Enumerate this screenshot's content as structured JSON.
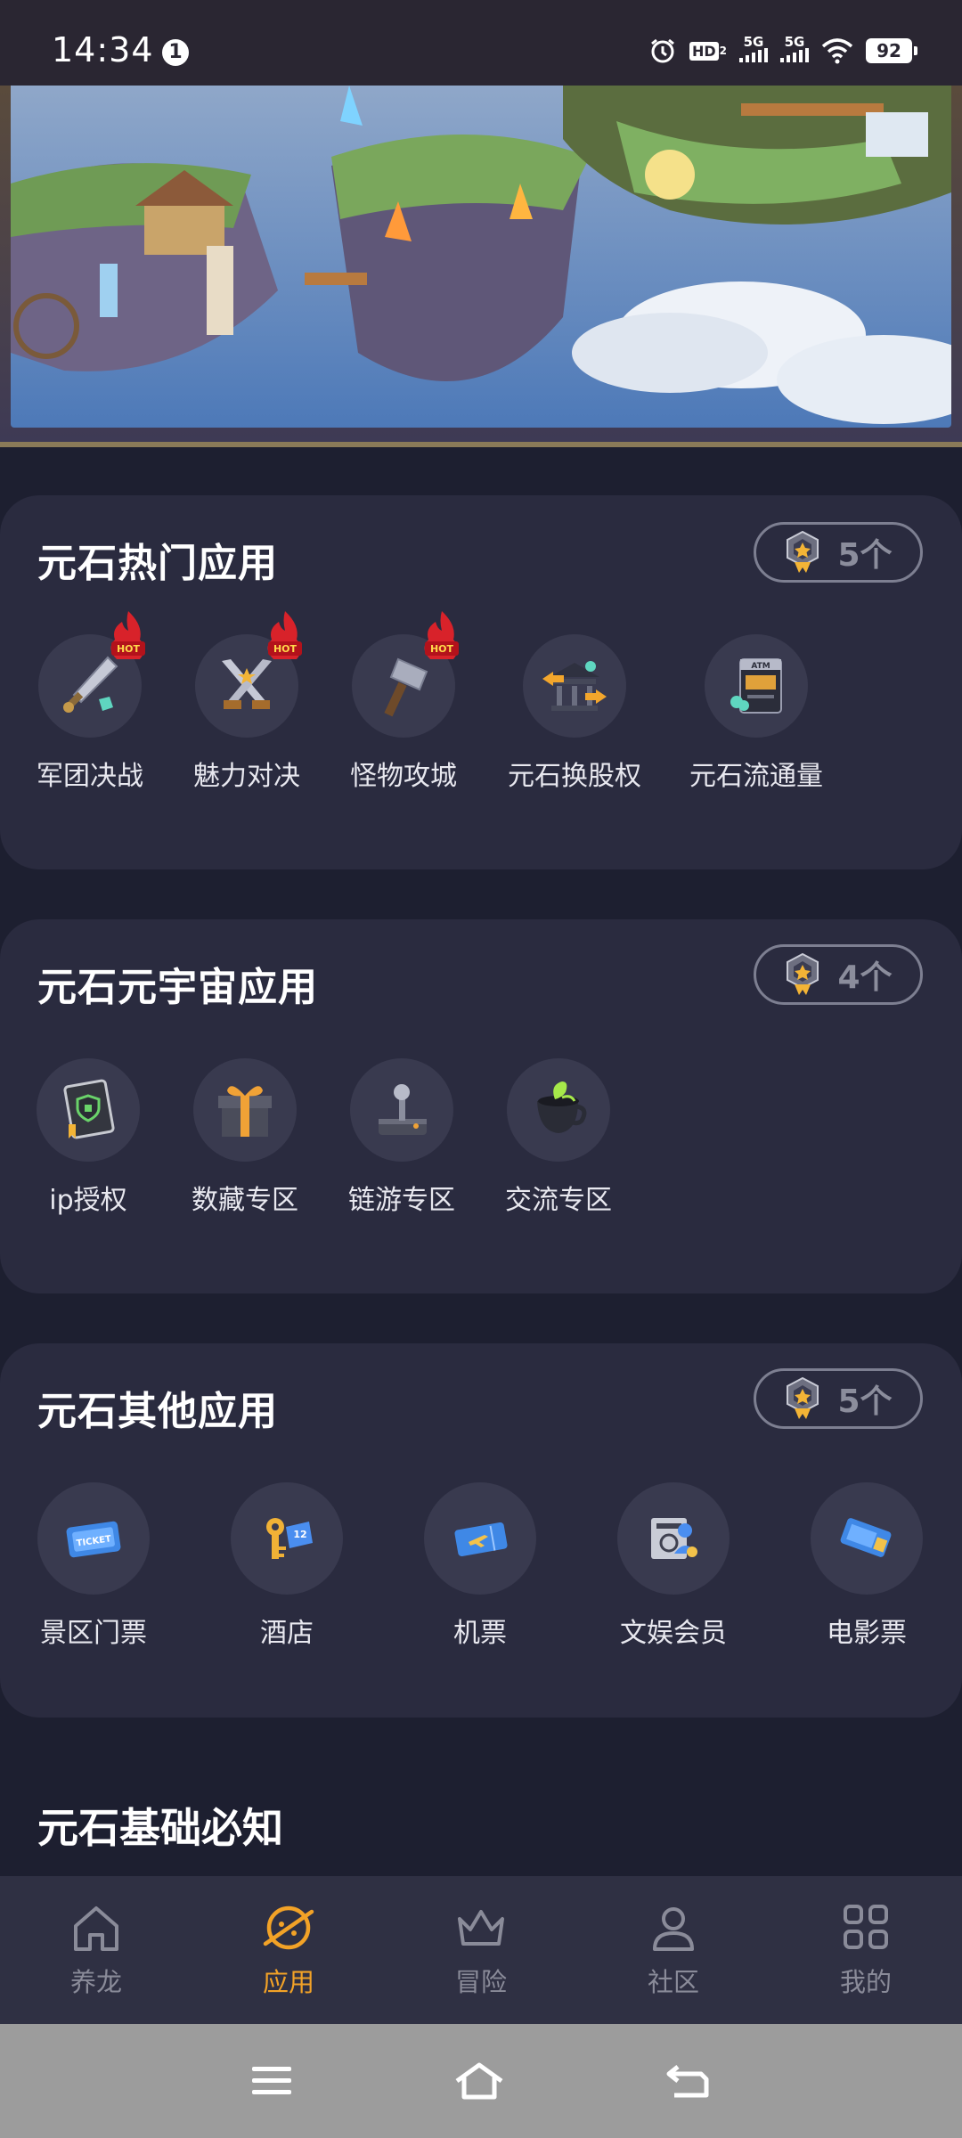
{
  "status_bar": {
    "time": "14:34",
    "notification_count": "1",
    "network_1": "5G",
    "network_2": "5G",
    "hd_label": "HD",
    "hd_sub": "2",
    "battery": "92"
  },
  "sections": [
    {
      "title": "元石热门应用",
      "count_label": "5个",
      "apps": [
        {
          "label": "军团决战",
          "icon": "sword-icon",
          "hot": true
        },
        {
          "label": "魅力对决",
          "icon": "crossed-swords-icon",
          "hot": true
        },
        {
          "label": "怪物攻城",
          "icon": "hammer-icon",
          "hot": true
        },
        {
          "label": "元石换股权",
          "icon": "bank-exchange-icon",
          "hot": false
        },
        {
          "label": "元石流通量",
          "icon": "atm-icon",
          "hot": false
        }
      ]
    },
    {
      "title": "元石元宇宙应用",
      "count_label": "4个",
      "apps": [
        {
          "label": "ip授权",
          "icon": "license-book-icon"
        },
        {
          "label": "数藏专区",
          "icon": "gift-box-icon"
        },
        {
          "label": "链游专区",
          "icon": "joystick-icon"
        },
        {
          "label": "交流专区",
          "icon": "tea-cup-icon"
        }
      ]
    },
    {
      "title": "元石其他应用",
      "count_label": "5个",
      "apps": [
        {
          "label": "景区门票",
          "icon": "ticket-icon"
        },
        {
          "label": "酒店",
          "icon": "hotel-key-icon"
        },
        {
          "label": "机票",
          "icon": "plane-ticket-icon"
        },
        {
          "label": "文娱会员",
          "icon": "membership-card-icon"
        },
        {
          "label": "电影票",
          "icon": "cinema-ticket-icon"
        }
      ]
    }
  ],
  "hot_badge": "HOT",
  "atm_text": "ATM",
  "ticket_text": "TICKET",
  "basics_title": "元石基础必知",
  "bottom_nav": [
    {
      "label": "养龙",
      "icon": "home-icon",
      "active": false
    },
    {
      "label": "应用",
      "icon": "planet-icon",
      "active": true
    },
    {
      "label": "冒险",
      "icon": "crown-icon",
      "active": false
    },
    {
      "label": "社区",
      "icon": "person-icon",
      "active": false
    },
    {
      "label": "我的",
      "icon": "grid-icon",
      "active": false
    }
  ],
  "colors": {
    "background": "#1d1f30",
    "card": "#2a2b3f",
    "icon_circle": "#393a4f",
    "accent": "#f2a227",
    "inactive": "#8a8b99"
  }
}
